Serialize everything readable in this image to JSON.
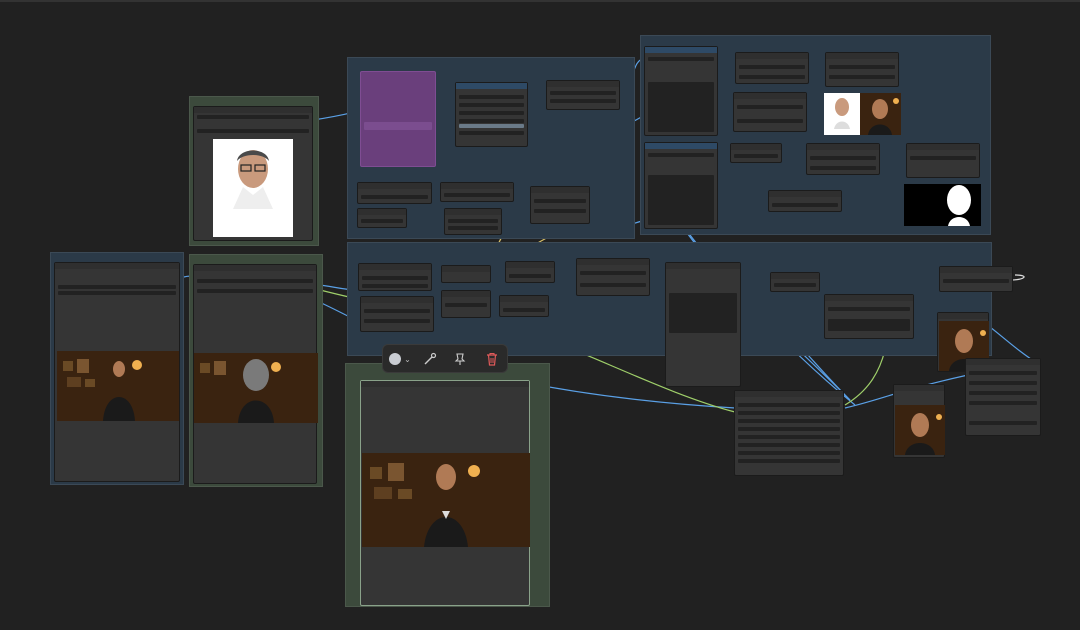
{
  "colors": {
    "background": "#212121",
    "group_blue": "#2b3a48",
    "group_green": "#3c4a3c",
    "node": "#353535",
    "prompt_node": "#6a3f7c",
    "link_blue": "#5aa0e6",
    "link_green": "#9fcf6a",
    "link_yellow": "#d8c06a",
    "link_pink": "#e07080",
    "link_white": "#e0e0e0",
    "delete_red": "#e05a5a"
  },
  "toolbar": {
    "color_icon": "color-swatch-icon",
    "chevron_icon": "chevron-down-icon",
    "link_icon": "wand-link-icon",
    "pin_icon": "pin-icon",
    "delete_icon": "trash-icon"
  }
}
